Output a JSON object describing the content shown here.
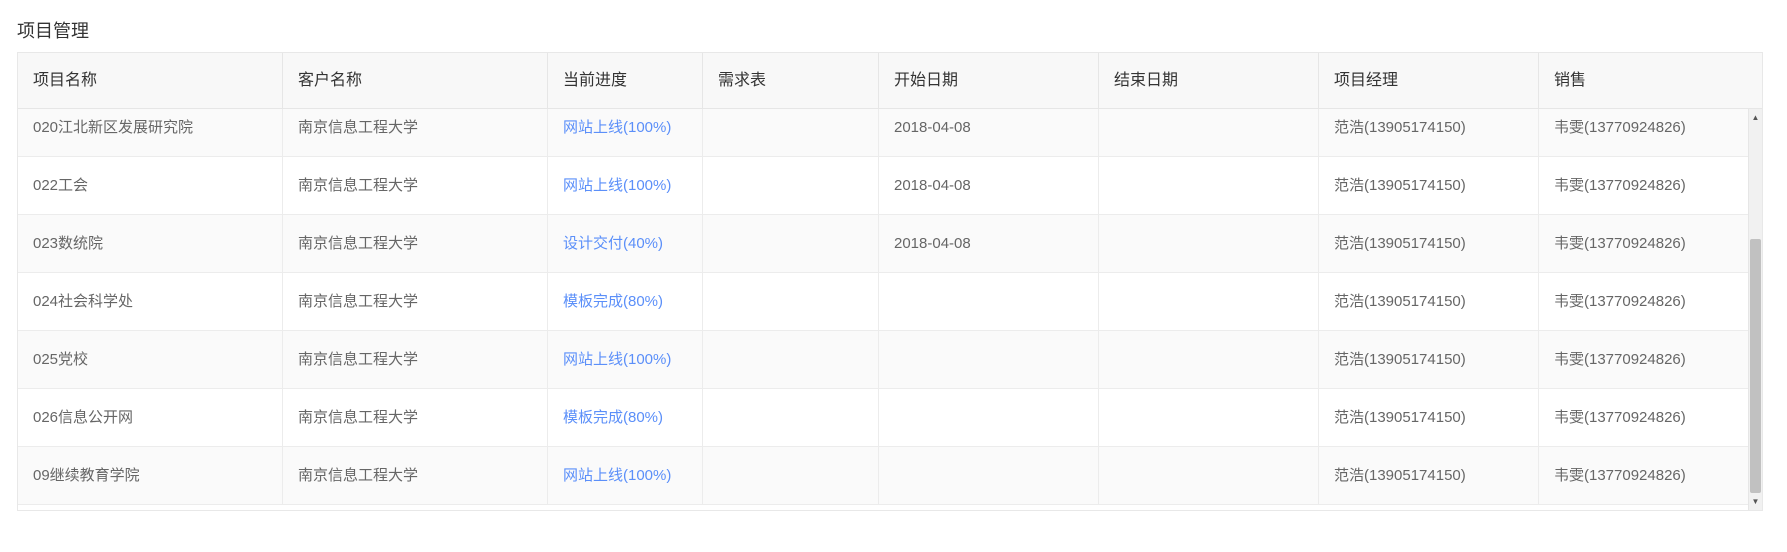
{
  "page": {
    "title": "项目管理"
  },
  "table": {
    "columns": [
      "项目名称",
      "客户名称",
      "当前进度",
      "需求表",
      "开始日期",
      "结束日期",
      "项目经理",
      "销售"
    ],
    "rows": [
      {
        "name": "020江北新区发展研究院",
        "client": "南京信息工程大学",
        "progress": "网站上线(100%)",
        "requirement": "",
        "start": "2018-04-08",
        "end": "",
        "manager": "范浩(13905174150)",
        "sales": "韦雯(13770924826)"
      },
      {
        "name": "022工会",
        "client": "南京信息工程大学",
        "progress": "网站上线(100%)",
        "requirement": "",
        "start": "2018-04-08",
        "end": "",
        "manager": "范浩(13905174150)",
        "sales": "韦雯(13770924826)"
      },
      {
        "name": "023数统院",
        "client": "南京信息工程大学",
        "progress": "设计交付(40%)",
        "requirement": "",
        "start": "2018-04-08",
        "end": "",
        "manager": "范浩(13905174150)",
        "sales": "韦雯(13770924826)"
      },
      {
        "name": "024社会科学处",
        "client": "南京信息工程大学",
        "progress": "模板完成(80%)",
        "requirement": "",
        "start": "",
        "end": "",
        "manager": "范浩(13905174150)",
        "sales": "韦雯(13770924826)"
      },
      {
        "name": "025党校",
        "client": "南京信息工程大学",
        "progress": "网站上线(100%)",
        "requirement": "",
        "start": "",
        "end": "",
        "manager": "范浩(13905174150)",
        "sales": "韦雯(13770924826)"
      },
      {
        "name": "026信息公开网",
        "client": "南京信息工程大学",
        "progress": "模板完成(80%)",
        "requirement": "",
        "start": "",
        "end": "",
        "manager": "范浩(13905174150)",
        "sales": "韦雯(13770924826)"
      },
      {
        "name": "09继续教育学院",
        "client": "南京信息工程大学",
        "progress": "网站上线(100%)",
        "requirement": "",
        "start": "",
        "end": "",
        "manager": "范浩(13905174150)",
        "sales": "韦雯(13770924826)"
      }
    ]
  },
  "icons": {
    "scroll_up": "scroll-up-arrow-icon",
    "scroll_down": "scroll-down-arrow-icon"
  },
  "colors": {
    "link": "#5b8ff9",
    "header_bg": "#f8f8f8"
  }
}
